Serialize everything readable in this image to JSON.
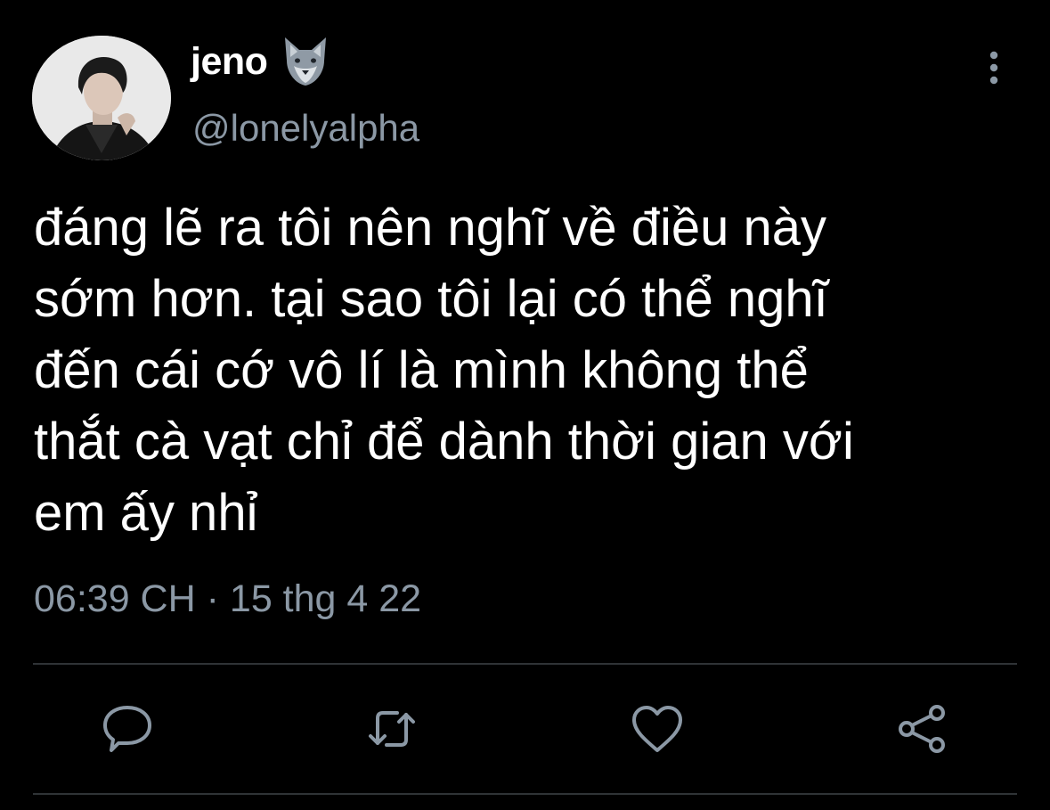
{
  "tweet": {
    "author": {
      "display_name": "jeno",
      "name_emoji": "wolf-emoji",
      "handle": "@lonelyalpha",
      "avatar": "profile-photo"
    },
    "text": "đáng lẽ ra tôi nên nghĩ về điều này\nsớm hơn. tại sao tôi lại có thể nghĩ\nđến cái cớ vô lí là mình không thể\nthắt cà vạt chỉ để dành thời gian với\nem ấy nhỉ",
    "time": "06:39 CH",
    "separator": "·",
    "date": "15 thg 4 22"
  },
  "actions": [
    {
      "icon": "reply-icon"
    },
    {
      "icon": "retweet-icon"
    },
    {
      "icon": "like-icon"
    },
    {
      "icon": "share-icon"
    }
  ],
  "colors": {
    "background": "#000000",
    "primary_text": "#ffffff",
    "secondary_text": "#8b98a5",
    "divider": "#2f3336"
  }
}
